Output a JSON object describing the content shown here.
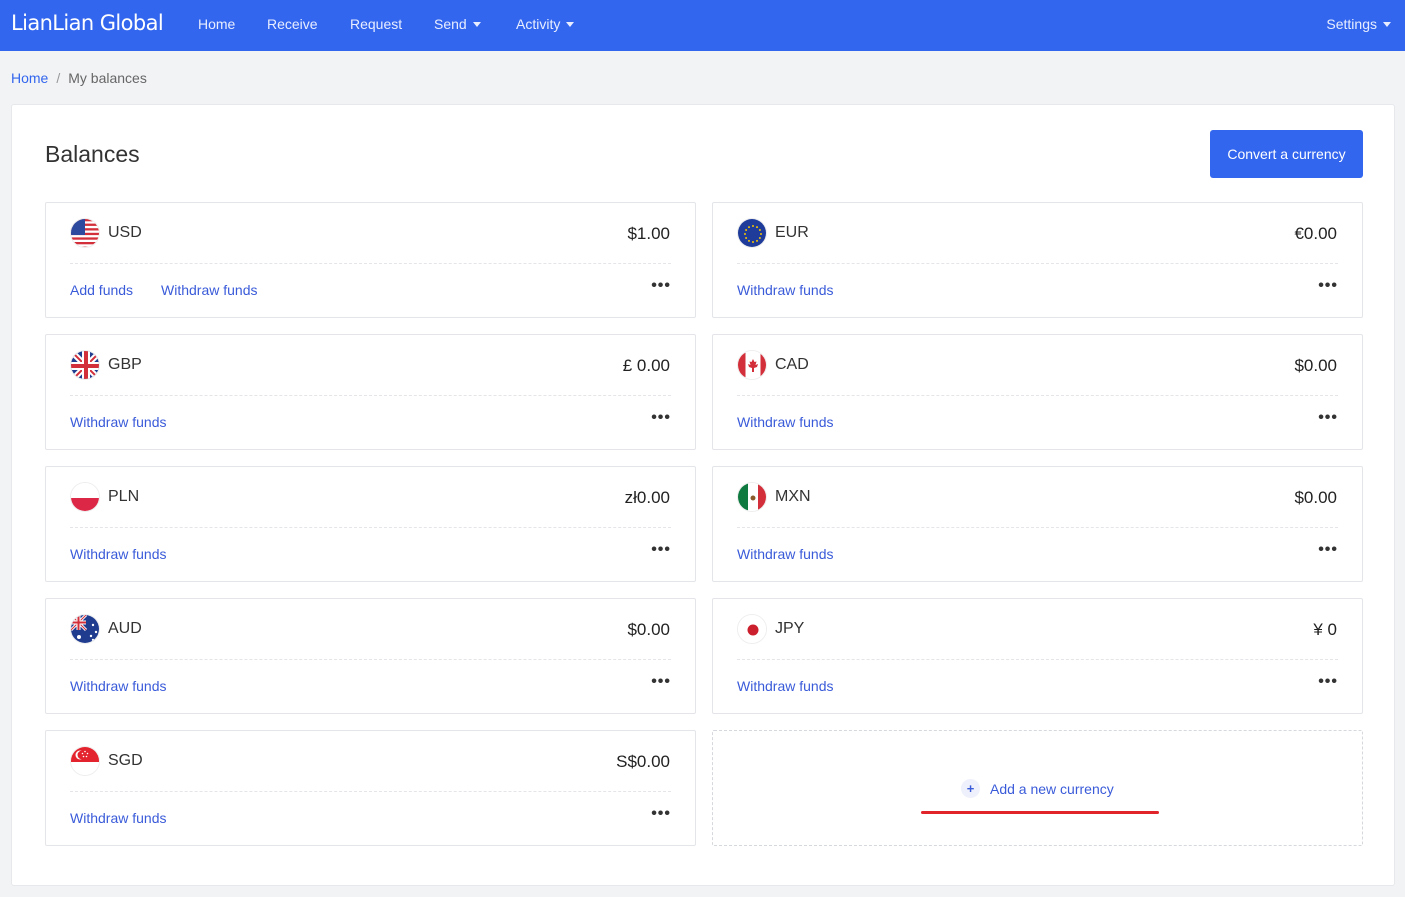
{
  "brand": {
    "logo": "LianLian Global"
  },
  "nav": {
    "items": [
      {
        "label": "Home",
        "has_dropdown": false
      },
      {
        "label": "Receive",
        "has_dropdown": false
      },
      {
        "label": "Request",
        "has_dropdown": false
      },
      {
        "label": "Send",
        "has_dropdown": true
      },
      {
        "label": "Activity",
        "has_dropdown": true
      }
    ],
    "settings": "Settings"
  },
  "breadcrumb": {
    "home": "Home",
    "separator": "/",
    "current": "My balances"
  },
  "page": {
    "title": "Balances",
    "convert_button": "Convert a currency"
  },
  "balances": [
    {
      "code": "USD",
      "amount": "$1.00",
      "actions": [
        "Add funds",
        "Withdraw funds"
      ],
      "flag": "us-flag-icon"
    },
    {
      "code": "EUR",
      "amount": "€0.00",
      "actions": [
        "Withdraw funds"
      ],
      "flag": "eu-flag-icon"
    },
    {
      "code": "GBP",
      "amount": "£ 0.00",
      "actions": [
        "Withdraw funds"
      ],
      "flag": "uk-flag-icon"
    },
    {
      "code": "CAD",
      "amount": "$0.00",
      "actions": [
        "Withdraw funds"
      ],
      "flag": "ca-flag-icon"
    },
    {
      "code": "PLN",
      "amount": "zł0.00",
      "actions": [
        "Withdraw funds"
      ],
      "flag": "pl-flag-icon"
    },
    {
      "code": "MXN",
      "amount": "$0.00",
      "actions": [
        "Withdraw funds"
      ],
      "flag": "mx-flag-icon"
    },
    {
      "code": "AUD",
      "amount": "$0.00",
      "actions": [
        "Withdraw funds"
      ],
      "flag": "au-flag-icon"
    },
    {
      "code": "JPY",
      "amount": "¥ 0",
      "actions": [
        "Withdraw funds"
      ],
      "flag": "jp-flag-icon"
    },
    {
      "code": "SGD",
      "amount": "S$0.00",
      "actions": [
        "Withdraw funds"
      ],
      "flag": "sg-flag-icon"
    }
  ],
  "more_menu_glyph": "•••",
  "add_currency": {
    "label": "Add a new currency",
    "icon": "+"
  },
  "colors": {
    "primary": "#3366ee",
    "link": "#3a5bd9",
    "highlight": "#e0242a"
  }
}
